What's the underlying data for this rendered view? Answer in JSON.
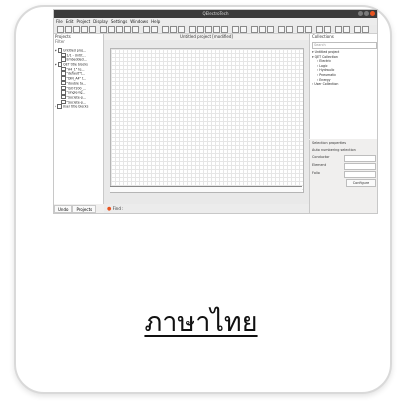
{
  "app": {
    "window_title": "QElectroTech",
    "menu": [
      "File",
      "Edit",
      "Project",
      "Display",
      "Settings",
      "Windows",
      "Help"
    ]
  },
  "projects_panel": {
    "title": "Projects",
    "filter_label": "Filter",
    "tree": [
      "Untitled proj...",
      "1/1 - Untit...",
      "Embedded...",
      "QET title blocks",
      "\"A4_1\" te...",
      "\"default\"t...",
      "\"DIN_A4\" t...",
      "\"double ta...",
      "\"ISO7200_...",
      "\"single-lig...",
      "\"Societe-p...",
      "\"Societe-p...",
      "User title blocks"
    ],
    "tabs": [
      "Undo",
      "Projects"
    ]
  },
  "editor": {
    "title": "Untitled project [modified]",
    "find_label": "Find :"
  },
  "collections_panel": {
    "title": "Collections",
    "search_placeholder": "Search",
    "tree": [
      "Untitled project",
      "QET Collection",
      "Electric",
      "Logic",
      "Hydraulic",
      "Pneumatic",
      "Energy",
      "User Collection"
    ]
  },
  "properties_panel": {
    "selection_title": "Selection properties",
    "numbering_title": "Auto numbering selection",
    "conductor_label": "Conductor",
    "element_label": "Element",
    "folio_label": "Folio",
    "configure_label": "Configure"
  },
  "heading": "ภาษาไทย"
}
